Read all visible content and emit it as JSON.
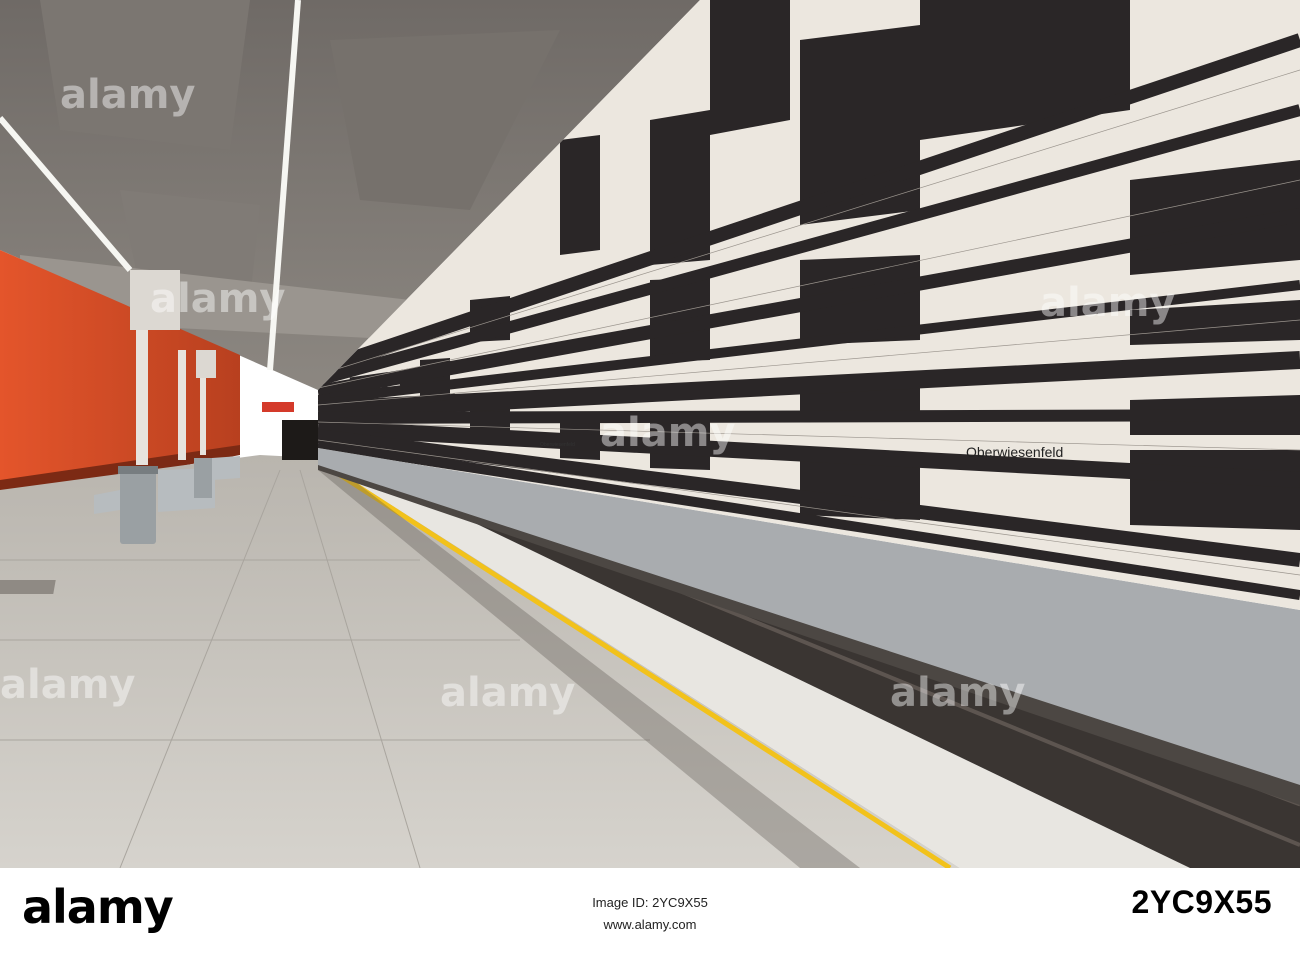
{
  "scene": {
    "station_sign_main": "Oberwiesenfeld",
    "station_sign_far": "Oberwiesenfeld",
    "watermark_text": "alamy",
    "colors": {
      "orange_wall": "#d84a24",
      "tile_black": "#2a2627",
      "tile_white": "#ece7df",
      "concrete": "#8a8580",
      "floor": "#c9c6c0",
      "safety_line": "#f2c21b"
    }
  },
  "footer": {
    "logo": "alamy",
    "image_id_label": "Image ID: 2YC9X55",
    "url": "www.alamy.com",
    "image_code": "2YC9X55"
  }
}
